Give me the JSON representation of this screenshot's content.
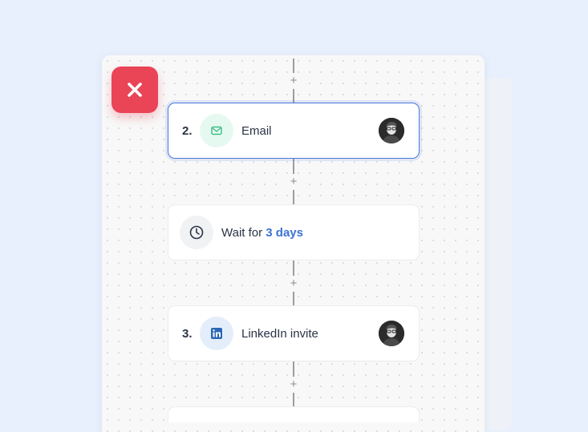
{
  "workflow": {
    "add_step_symbol": "+",
    "steps": [
      {
        "number": "2.",
        "title": "Email",
        "icon": "mail-icon",
        "icon_bg": "#e6f9f0",
        "icon_color": "#3fbf84",
        "selected": true
      },
      {
        "wait_prefix": "Wait for",
        "wait_value": "3 days",
        "icon": "clock-icon"
      },
      {
        "number": "3.",
        "title": "LinkedIn invite",
        "icon": "linkedin-icon",
        "icon_bg": "#e4eefb",
        "icon_color": "#2b67b5",
        "selected": false
      }
    ]
  },
  "error_badge": {
    "icon": "close-icon",
    "color": "#ea4457"
  },
  "colors": {
    "accent": "#3d72d4",
    "selected_border": "#4b79dc",
    "background": "#e8f0fd"
  }
}
